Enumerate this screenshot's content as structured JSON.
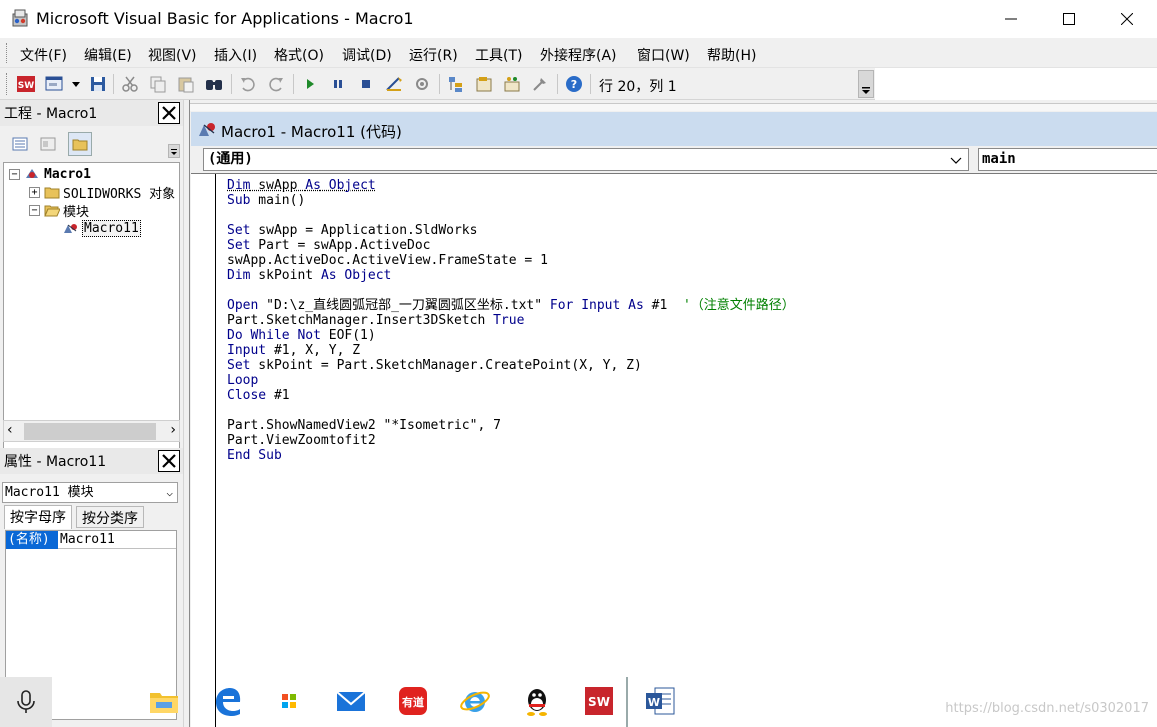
{
  "window": {
    "title": "Microsoft Visual Basic for Applications - Macro1"
  },
  "menu": {
    "items": [
      "文件(F)",
      "编辑(E)",
      "视图(V)",
      "插入(I)",
      "格式(O)",
      "调试(D)",
      "运行(R)",
      "工具(T)",
      "外接程序(A)",
      "窗口(W)",
      "帮助(H)"
    ]
  },
  "toolbar": {
    "cursor_position": "行 20，列 1"
  },
  "project_pane": {
    "title": "工程 - Macro1",
    "tree": {
      "root": "Macro1",
      "solidworks_node": "SOLIDWORKS 对象",
      "modules_node": "模块",
      "module_item": "Macro11"
    }
  },
  "properties_pane": {
    "title": "属性 - Macro11",
    "object_select": "Macro11 模块",
    "tabs": [
      "按字母序",
      "按分类序"
    ],
    "rows": [
      {
        "name": "(名称)",
        "value": "Macro11"
      }
    ]
  },
  "code_window": {
    "title": "Macro1 - Macro11 (代码)",
    "object_combo": "(通用)",
    "procedure_combo": "main",
    "lines": [
      [
        {
          "k": "kw",
          "t": "Dim"
        },
        {
          "t": " swApp "
        },
        {
          "k": "kw",
          "t": "As"
        },
        {
          "t": " "
        },
        {
          "k": "kw",
          "t": "Object"
        }
      ],
      [
        {
          "k": "kw",
          "t": "Sub"
        },
        {
          "t": " main()"
        }
      ],
      [],
      [
        {
          "k": "kw",
          "t": "Set"
        },
        {
          "t": " swApp = Application.SldWorks"
        }
      ],
      [
        {
          "k": "kw",
          "t": "Set"
        },
        {
          "t": " Part = swApp.ActiveDoc"
        }
      ],
      [
        {
          "t": "swApp.ActiveDoc.ActiveView.FrameState = 1"
        }
      ],
      [
        {
          "k": "kw",
          "t": "Dim"
        },
        {
          "t": " skPoint "
        },
        {
          "k": "kw",
          "t": "As"
        },
        {
          "t": " "
        },
        {
          "k": "kw",
          "t": "Object"
        }
      ],
      [],
      [
        {
          "k": "kw",
          "t": "Open"
        },
        {
          "t": " \"D:\\z_直线圆弧冠部_一刀翼圆弧区坐标.txt\" "
        },
        {
          "k": "kw",
          "t": "For Input As"
        },
        {
          "t": " #1  "
        },
        {
          "k": "cm",
          "t": "'（注意文件路径）"
        }
      ],
      [
        {
          "t": "Part.SketchManager.Insert3DSketch "
        },
        {
          "k": "kw",
          "t": "True"
        }
      ],
      [
        {
          "k": "kw",
          "t": "Do While Not"
        },
        {
          "t": " EOF(1)"
        }
      ],
      [
        {
          "k": "kw",
          "t": "Input"
        },
        {
          "t": " #1, X, Y, Z"
        }
      ],
      [
        {
          "k": "kw",
          "t": "Set"
        },
        {
          "t": " skPoint = Part.SketchManager.CreatePoint(X, Y, Z)"
        }
      ],
      [
        {
          "k": "kw",
          "t": "Loop"
        }
      ],
      [
        {
          "k": "kw",
          "t": "Close"
        },
        {
          "t": " #1"
        }
      ],
      [],
      [
        {
          "t": "Part.ShowNamedView2 \"*Isometric\", 7"
        }
      ],
      [
        {
          "t": "Part.ViewZoomtofit2"
        }
      ],
      [
        {
          "k": "kw",
          "t": "End Sub"
        }
      ]
    ]
  },
  "taskbar": {
    "apps": [
      "microphone-icon",
      "file-explorer-icon",
      "edge-icon",
      "store-icon",
      "mail-icon",
      "youdao-icon",
      "ie-icon",
      "qq-icon",
      "solidworks-icon",
      "word-icon"
    ],
    "watermark": "https://blog.csdn.net/s0302017"
  }
}
